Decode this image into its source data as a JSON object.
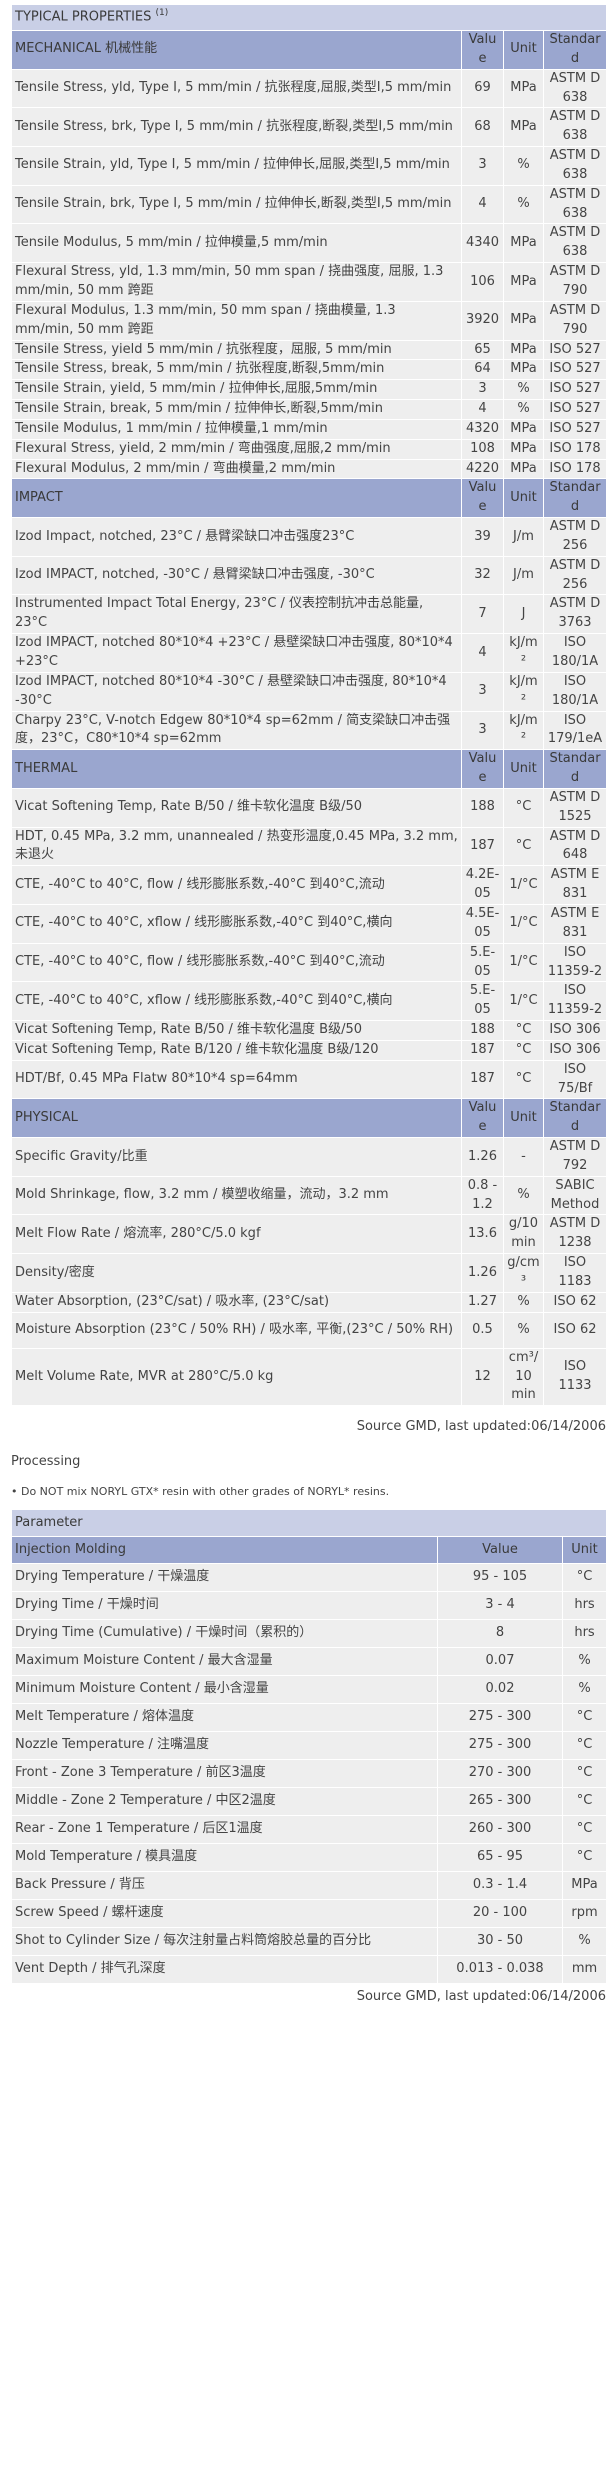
{
  "properties_table": {
    "title": "TYPICAL PROPERTIES",
    "title_note": "(1)",
    "column_headers": {
      "value": "Value",
      "unit": "Unit",
      "standard": "Standard"
    },
    "sections": [
      {
        "name": "MECHANICAL 机械性能",
        "rows": [
          {
            "property": "Tensile Stress, yld, Type I, 5 mm/min / 抗张程度,屈服,类型I,5 mm/min",
            "value": "69",
            "unit": "MPa",
            "standard": "ASTM D 638"
          },
          {
            "property": "Tensile Stress, brk, Type I, 5 mm/min / 抗张程度,断裂,类型I,5 mm/min",
            "value": "68",
            "unit": "MPa",
            "standard": "ASTM D 638"
          },
          {
            "property": "Tensile Strain, yld, Type I, 5 mm/min / 拉伸伸长,屈服,类型I,5 mm/min",
            "value": "3",
            "unit": "%",
            "standard": "ASTM D 638"
          },
          {
            "property": "Tensile Strain, brk, Type I, 5 mm/min / 拉伸伸长,断裂,类型I,5 mm/min",
            "value": "4",
            "unit": "%",
            "standard": "ASTM D 638"
          },
          {
            "property": "Tensile Modulus, 5 mm/min / 拉伸模量,5 mm/min",
            "value": "4340",
            "unit": "MPa",
            "standard": "ASTM D 638"
          },
          {
            "property": "Flexural Stress, yld, 1.3 mm/min, 50 mm span / 挠曲强度, 屈服, 1.3 mm/min, 50 mm 跨距",
            "value": "106",
            "unit": "MPa",
            "standard": "ASTM D 790"
          },
          {
            "property": "Flexural Modulus, 1.3 mm/min, 50 mm span / 挠曲模量, 1.3 mm/min, 50 mm 跨距",
            "value": "3920",
            "unit": "MPa",
            "standard": "ASTM D 790"
          },
          {
            "property": "Tensile Stress, yield 5 mm/min / 抗张程度，屈服, 5 mm/min",
            "value": "65",
            "unit": "MPa",
            "standard": "ISO 527"
          },
          {
            "property": "Tensile Stress, break, 5 mm/min / 抗张程度,断裂,5mm/min",
            "value": "64",
            "unit": "MPa",
            "standard": "ISO 527"
          },
          {
            "property": "Tensile Strain, yield, 5 mm/min / 拉伸伸长,屈服,5mm/min",
            "value": "3",
            "unit": "%",
            "standard": "ISO 527"
          },
          {
            "property": "Tensile Strain, break, 5 mm/min / 拉伸伸长,断裂,5mm/min",
            "value": "4",
            "unit": "%",
            "standard": "ISO 527"
          },
          {
            "property": "Tensile Modulus, 1 mm/min / 拉伸模量,1 mm/min",
            "value": "4320",
            "unit": "MPa",
            "standard": "ISO 527"
          },
          {
            "property": "Flexural Stress, yield, 2 mm/min / 弯曲强度,屈服,2 mm/min",
            "value": "108",
            "unit": "MPa",
            "standard": "ISO 178"
          },
          {
            "property": "Flexural Modulus, 2 mm/min / 弯曲模量,2 mm/min",
            "value": "4220",
            "unit": "MPa",
            "standard": "ISO 178"
          }
        ]
      },
      {
        "name": "IMPACT",
        "rows": [
          {
            "property": "Izod Impact, notched, 23°C / 悬臂梁缺口冲击强度23°C",
            "value": "39",
            "unit": "J/m",
            "standard": "ASTM D 256"
          },
          {
            "property": "Izod IMPACT, notched, -30°C / 悬臂梁缺口冲击强度, -30°C",
            "value": "32",
            "unit": "J/m",
            "standard": "ASTM D 256"
          },
          {
            "property": "Instrumented Impact Total Energy, 23°C / 仪表控制抗冲击总能量, 23°C",
            "value": "7",
            "unit": "J",
            "standard": "ASTM D 3763"
          },
          {
            "property": "Izod IMPACT, notched 80*10*4 +23°C / 悬壁梁缺口冲击强度, 80*10*4 +23°C",
            "value": "4",
            "unit": "kJ/m²",
            "standard": "ISO 180/1A"
          },
          {
            "property": "Izod IMPACT, notched 80*10*4 -30°C / 悬壁梁缺口冲击强度, 80*10*4 -30°C",
            "value": "3",
            "unit": "kJ/m²",
            "standard": "ISO 180/1A"
          },
          {
            "property": "Charpy 23°C, V-notch Edgew 80*10*4 sp=62mm / 简支梁缺口冲击强度，23°C，C80*10*4 sp=62mm",
            "value": "3",
            "unit": "kJ/m²",
            "standard": "ISO 179/1eA"
          }
        ]
      },
      {
        "name": "THERMAL",
        "rows": [
          {
            "property": "Vicat Softening Temp, Rate B/50 / 维卡软化温度 B级/50",
            "value": "188",
            "unit": "°C",
            "standard": "ASTM D 1525"
          },
          {
            "property": "HDT, 0.45 MPa, 3.2 mm, unannealed / 热变形温度,0.45 MPa, 3.2 mm,未退火",
            "value": "187",
            "unit": "°C",
            "standard": "ASTM D 648"
          },
          {
            "property": "CTE, -40°C to 40°C, flow / 线形膨胀系数,-40°C 到40°C,流动",
            "value": "4.2E-05",
            "unit": "1/°C",
            "standard": "ASTM E 831"
          },
          {
            "property": "CTE, -40°C to 40°C, xflow / 线形膨胀系数,-40°C 到40°C,横向",
            "value": "4.5E-05",
            "unit": "1/°C",
            "standard": "ASTM E 831"
          },
          {
            "property": "CTE, -40°C to 40°C, flow / 线形膨胀系数,-40°C 到40°C,流动",
            "value": "5.E-05",
            "unit": "1/°C",
            "standard": "ISO 11359-2"
          },
          {
            "property": "CTE, -40°C to 40°C, xflow / 线形膨胀系数,-40°C 到40°C,横向",
            "value": "5.E-05",
            "unit": "1/°C",
            "standard": "ISO 11359-2"
          },
          {
            "property": "Vicat Softening Temp, Rate B/50 / 维卡软化温度 B级/50",
            "value": "188",
            "unit": "°C",
            "standard": "ISO 306"
          },
          {
            "property": "Vicat Softening Temp, Rate B/120 / 维卡软化温度 B级/120",
            "value": "187",
            "unit": "°C",
            "standard": "ISO 306"
          },
          {
            "property": "HDT/Bf, 0.45 MPa Flatw 80*10*4 sp=64mm",
            "value": "187",
            "unit": "°C",
            "standard": "ISO 75/Bf"
          }
        ]
      },
      {
        "name": "PHYSICAL",
        "rows": [
          {
            "property": "Specific Gravity/比重",
            "value": "1.26",
            "unit": "-",
            "standard": "ASTM D 792"
          },
          {
            "property": "Mold Shrinkage, flow, 3.2 mm / 模塑收缩量，流动，3.2 mm",
            "value": "0.8 - 1.2",
            "unit": "%",
            "standard": "SABIC Method"
          },
          {
            "property": "Melt Flow Rate / 熔流率, 280°C/5.0 kgf",
            "value": "13.6",
            "unit": "g/10 min",
            "standard": "ASTM D 1238"
          },
          {
            "property": "Density/密度",
            "value": "1.26",
            "unit": "g/cm³",
            "standard": "ISO 1183"
          },
          {
            "property": "Water Absorption, (23°C/sat) / 吸水率, (23°C/sat)",
            "value": "1.27",
            "unit": "%",
            "standard": "ISO 62"
          },
          {
            "property": "Moisture Absorption (23°C / 50% RH) / 吸水率, 平衡,(23°C / 50% RH)",
            "value": "0.5",
            "unit": "%",
            "standard": "ISO 62"
          },
          {
            "property": "Melt Volume Rate, MVR at 280°C/5.0 kg",
            "value": "12",
            "unit": "cm³/10 min",
            "standard": "ISO 1133"
          }
        ]
      }
    ]
  },
  "source_line_1": "Source GMD, last updated:06/14/2006",
  "processing": {
    "title": "Processing",
    "note": "• Do NOT mix NORYL GTX* resin with other grades of NORYL* resins.",
    "header": {
      "parameter": "Parameter"
    },
    "section_name": "Injection Molding",
    "column_headers": {
      "value": "Value",
      "unit": "Unit"
    },
    "rows": [
      {
        "parameter": "Drying Temperature / 干燥温度",
        "value": "95 - 105",
        "unit": "°C"
      },
      {
        "parameter": "Drying Time / 干燥时间",
        "value": "3 - 4",
        "unit": "hrs"
      },
      {
        "parameter": "Drying Time (Cumulative) / 干燥时间（累积的）",
        "value": "8",
        "unit": "hrs"
      },
      {
        "parameter": "Maximum Moisture Content / 最大含湿量",
        "value": "0.07",
        "unit": "%"
      },
      {
        "parameter": "Minimum Moisture Content / 最小含湿量",
        "value": "0.02",
        "unit": "%"
      },
      {
        "parameter": "Melt Temperature / 熔体温度",
        "value": "275 - 300",
        "unit": "°C"
      },
      {
        "parameter": "Nozzle Temperature / 注嘴温度",
        "value": "275 - 300",
        "unit": "°C"
      },
      {
        "parameter": "Front - Zone 3 Temperature / 前区3温度",
        "value": "270 - 300",
        "unit": "°C"
      },
      {
        "parameter": "Middle - Zone 2 Temperature / 中区2温度",
        "value": "265 - 300",
        "unit": "°C"
      },
      {
        "parameter": "Rear - Zone 1 Temperature / 后区1温度",
        "value": "260 - 300",
        "unit": "°C"
      },
      {
        "parameter": "Mold Temperature / 模具温度",
        "value": "65 - 95",
        "unit": "°C"
      },
      {
        "parameter": "Back Pressure / 背压",
        "value": "0.3 - 1.4",
        "unit": "MPa"
      },
      {
        "parameter": "Screw Speed / 螺杆速度",
        "value": "20 - 100",
        "unit": "rpm"
      },
      {
        "parameter": "Shot to Cylinder Size / 每次注射量占料筒熔胶总量的百分比",
        "value": "30 - 50",
        "unit": "%"
      },
      {
        "parameter": "Vent Depth / 排气孔深度",
        "value": "0.013 - 0.038",
        "unit": "mm"
      }
    ]
  },
  "source_line_2": "Source GMD, last updated:06/14/2006"
}
